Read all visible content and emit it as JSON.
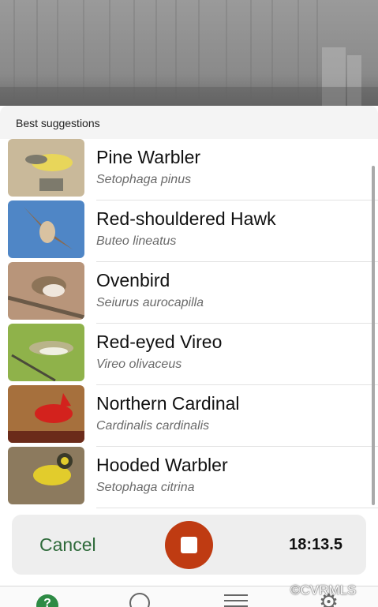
{
  "header": {
    "section_title": "Best suggestions"
  },
  "suggestions": [
    {
      "common_name": "Pine Warbler",
      "scientific_name": "Setophaga pinus",
      "thumb_colors": [
        "#c9b99a",
        "#e8d65a",
        "#7d7a6c"
      ]
    },
    {
      "common_name": "Red-shouldered Hawk",
      "scientific_name": "Buteo lineatus",
      "thumb_colors": [
        "#4f86c6",
        "#8a6a4e",
        "#d9c2a1"
      ]
    },
    {
      "common_name": "Ovenbird",
      "scientific_name": "Seiurus aurocapilla",
      "thumb_colors": [
        "#b8957a",
        "#8d7458",
        "#efe6dc"
      ]
    },
    {
      "common_name": "Red-eyed Vireo",
      "scientific_name": "Vireo olivaceus",
      "thumb_colors": [
        "#8fb24a",
        "#b9b48a",
        "#f0efe2"
      ]
    },
    {
      "common_name": "Northern Cardinal",
      "scientific_name": "Cardinalis cardinalis",
      "thumb_colors": [
        "#a6703d",
        "#d3221d",
        "#6b2b1a"
      ]
    },
    {
      "common_name": "Hooded Warbler",
      "scientific_name": "Setophaga citrina",
      "thumb_colors": [
        "#8c7a5e",
        "#e2cc2c",
        "#3a3a2a"
      ]
    }
  ],
  "controls": {
    "cancel_label": "Cancel",
    "timer": "18:13.5",
    "record_color": "#bf3b12"
  },
  "tabbar": {
    "help_badge": "?"
  },
  "watermark": "©CVRMLS"
}
